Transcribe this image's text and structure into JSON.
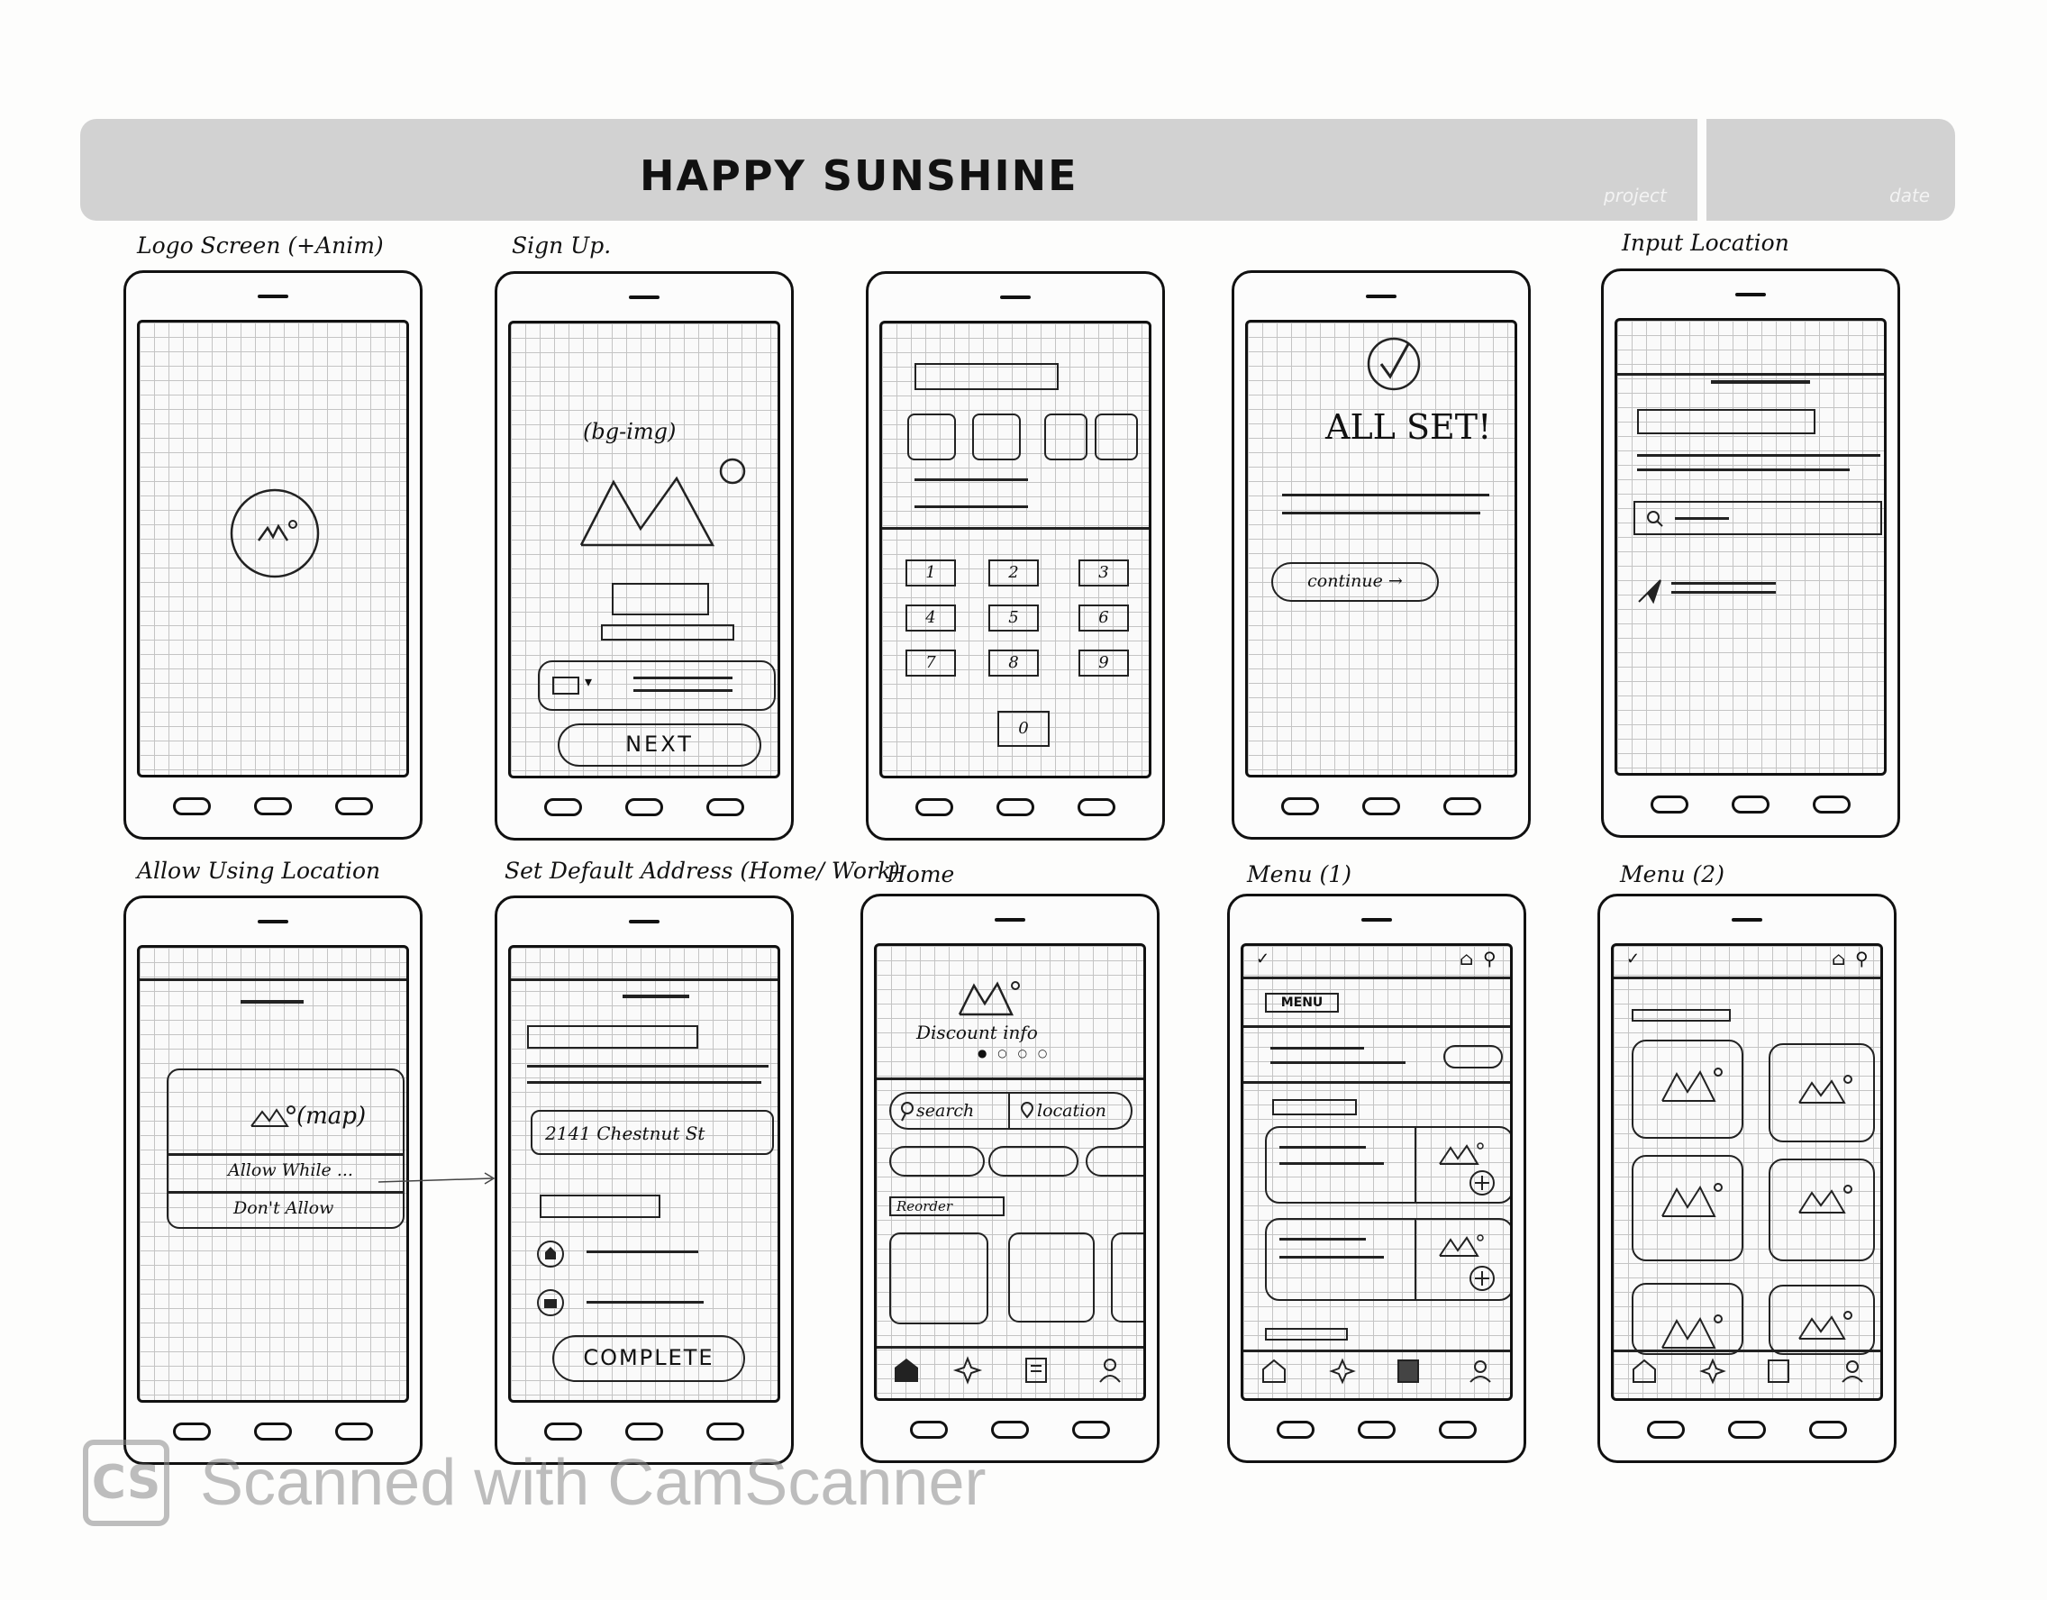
{
  "header": {
    "title": "HAPPY SUNSHINE",
    "project_label": "project",
    "date_label": "date"
  },
  "screens": [
    {
      "label": "Logo Screen (+Anim)"
    },
    {
      "label": "Sign Up."
    },
    {
      "label": ""
    },
    {
      "label": ""
    },
    {
      "label": "Input Location"
    },
    {
      "label": "Allow Using Location"
    },
    {
      "label": "Set Default Address (Home/ Work)"
    },
    {
      "label": "Home"
    },
    {
      "label": "Menu (1)"
    },
    {
      "label": "Menu (2)"
    }
  ],
  "signup": {
    "bg_img": "(bg-img)",
    "next_button": "NEXT"
  },
  "keypad": {
    "keys": [
      "1",
      "2",
      "3",
      "4",
      "5",
      "6",
      "7",
      "8",
      "9",
      "0"
    ]
  },
  "allset": {
    "title": "ALL SET!",
    "continue_button": "continue →"
  },
  "allow_location": {
    "map": "(map)",
    "allow": "Allow While ...",
    "deny": "Don't Allow"
  },
  "address": {
    "value": "2141 Chestnut St",
    "complete_button": "COMPLETE"
  },
  "home": {
    "discount": "Discount info",
    "search": "search",
    "location": "location",
    "reorder": "Reorder"
  },
  "menu1": {
    "tag": "MENU"
  },
  "watermark": {
    "logo": "CS",
    "text": "Scanned with CamScanner"
  }
}
